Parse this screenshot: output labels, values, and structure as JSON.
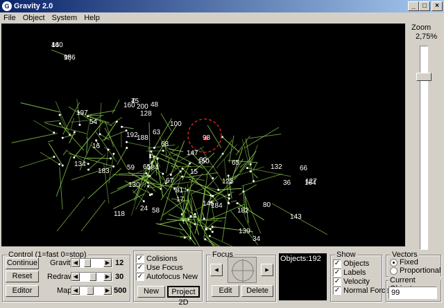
{
  "window": {
    "title": "Gravity 2.0",
    "minimize": "_",
    "maximize": "□",
    "close": "×",
    "icon_glyph": "G"
  },
  "menu": [
    "File",
    "Object",
    "System",
    "Help"
  ],
  "zoom": {
    "label": "Zoom",
    "value": "2,75%",
    "slider_level": 0.02
  },
  "control": {
    "title": "Control (1=fast 0=stop)",
    "continue_label": "Continue",
    "reset_label": "Reset",
    "editor_label": "Editor",
    "gravity_label": "Gravity",
    "gravity_value": "12",
    "redraw_label": "Redraw",
    "redraw_value": "30",
    "map_label": "Map",
    "map_value": "500"
  },
  "options": {
    "collisions": "Colisions",
    "use_focus": "Use Focus",
    "autofocus": "Autofocus New",
    "new_label": "New",
    "project_label": "Project 2D"
  },
  "focus": {
    "title": "Focus",
    "edit_label": "Edit",
    "delete_label": "Delete"
  },
  "objects_label": "Objects:192",
  "show": {
    "title": "Show",
    "objects": "Objects",
    "labels": "Labels",
    "velocity": "Velocity",
    "normal_force": "Normal Force"
  },
  "vectors": {
    "title": "Vectors",
    "fixed": "Fixed",
    "proportional": "Proportional"
  },
  "current_object": {
    "title": "Current Object",
    "value": "99"
  },
  "canvas_labels": [
    "140",
    "186",
    "45",
    "200",
    "48",
    "160",
    "128",
    "197",
    "54",
    "100",
    "98",
    "192",
    "188",
    "63",
    "68",
    "16",
    "184",
    "147",
    "134",
    "59",
    "130",
    "125",
    "183",
    "65",
    "67",
    "66",
    "132",
    "164",
    "36",
    "127",
    "143",
    "118",
    "24",
    "58",
    "184",
    "139",
    "34",
    "80",
    "182",
    "81",
    "145",
    "15",
    "65",
    "150",
    "17",
    "60",
    "46",
    "95",
    "7"
  ],
  "colors": {
    "canvas_bg": "#000000",
    "trail": "#8fd14f",
    "label": "#ffffff",
    "focus_ring": "#d42020"
  }
}
